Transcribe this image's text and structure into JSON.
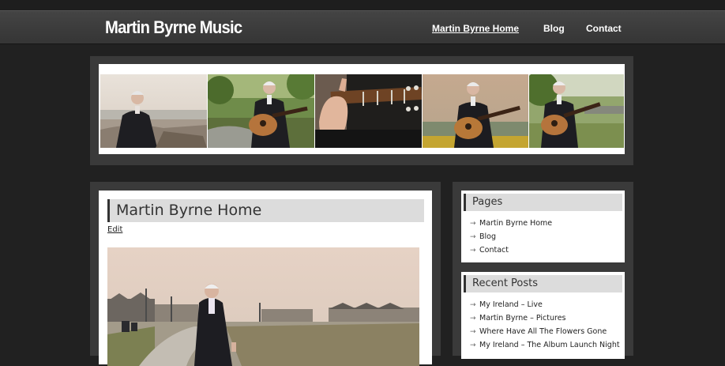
{
  "header": {
    "site_title": "Martin Byrne Music",
    "nav": [
      {
        "label": "Martin Byrne Home",
        "active": true
      },
      {
        "label": "Blog",
        "active": false
      },
      {
        "label": "Contact",
        "active": false
      }
    ]
  },
  "main": {
    "page_title": "Martin Byrne Home",
    "edit_label": "Edit"
  },
  "sidebar": {
    "pages": {
      "title": "Pages",
      "items": [
        "Martin Byrne Home",
        "Blog",
        "Contact"
      ]
    },
    "recent_posts": {
      "title": "Recent Posts",
      "items": [
        "My Ireland – Live",
        "Martin Byrne – Pictures",
        "Where Have All The Flowers Gone",
        "My Ireland – The Album Launch Night"
      ]
    }
  },
  "colors": {
    "background": "#212121",
    "header": "#3c3c3c",
    "panel": "#3a3a3a",
    "title_bar": "#dcdcdc",
    "text": "#222222"
  }
}
